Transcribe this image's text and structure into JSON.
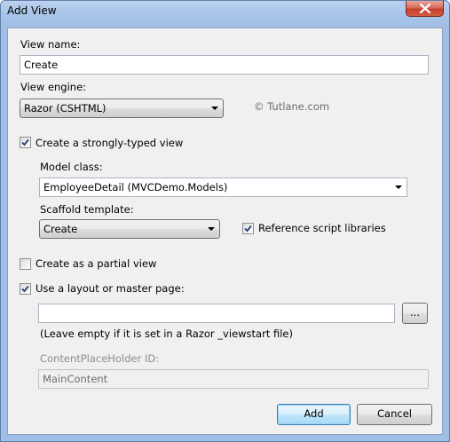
{
  "window": {
    "title": "Add View"
  },
  "form": {
    "view_name_label": "View name:",
    "view_name_value": "Create",
    "view_engine_label": "View engine:",
    "view_engine_value": "Razor (CSHTML)",
    "watermark": "© Tutlane.com",
    "strongly_typed_label": "Create a strongly-typed view",
    "strongly_typed_checked": true,
    "model_class_label": "Model class:",
    "model_class_value": "EmployeeDetail (MVCDemo.Models)",
    "scaffold_label": "Scaffold template:",
    "scaffold_value": "Create",
    "reference_scripts_label": "Reference script libraries",
    "reference_scripts_checked": true,
    "partial_view_label": "Create as a partial view",
    "partial_view_checked": false,
    "layout_label": "Use a layout or master page:",
    "layout_checked": true,
    "layout_path_value": "",
    "browse_label": "...",
    "layout_hint": "(Leave empty if it is set in a Razor _viewstart file)",
    "placeholder_id_label": "ContentPlaceHolder ID:",
    "placeholder_id_value": "MainContent"
  },
  "buttons": {
    "add_label": "Add",
    "cancel_label": "Cancel"
  },
  "colors": {
    "title_bar": "#a1bfe6",
    "close_button": "#c2402c",
    "dialog_background": "#f0f0f0",
    "default_button": "#bee6fd"
  }
}
